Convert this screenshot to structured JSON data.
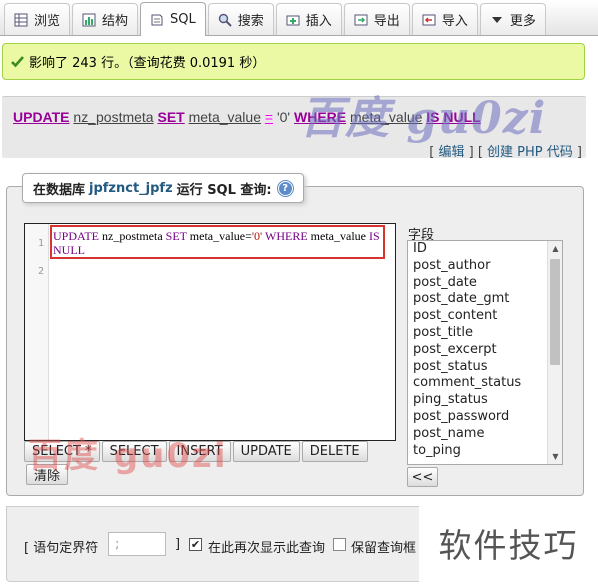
{
  "tabs": [
    {
      "label": "浏览",
      "icon": "browse-icon"
    },
    {
      "label": "结构",
      "icon": "structure-icon"
    },
    {
      "label": "SQL",
      "icon": "sql-icon",
      "active": true
    },
    {
      "label": "搜索",
      "icon": "search-icon"
    },
    {
      "label": "插入",
      "icon": "insert-icon"
    },
    {
      "label": "导出",
      "icon": "export-icon"
    },
    {
      "label": "导入",
      "icon": "import-icon"
    },
    {
      "label": "更多",
      "icon": "chevron-down-icon"
    }
  ],
  "message": {
    "text": "影响了 243 行。（查询花费 0.0191 秒）",
    "color": "#ebf8a4"
  },
  "sql_display": {
    "kw_update": "UPDATE",
    "table": "nz_postmeta",
    "kw_set": "SET",
    "column": "meta_value",
    "op": "=",
    "value": "'0'",
    "kw_where": "WHERE",
    "column2": "meta_value",
    "kw_is_null": "IS NULL",
    "edit_link": "编辑",
    "create_php_link": "创建 PHP 代码"
  },
  "watermark_top": "百度 gu0zi",
  "query_box": {
    "legend_prefix": "在数据库",
    "database": "jpfznct_jpfz",
    "legend_suffix": "运行 SQL 查询:",
    "help_icon": "help-icon"
  },
  "editor": {
    "line_numbers": [
      "1",
      "2"
    ],
    "kw_update": "UPDATE",
    "table": "nz_postmeta",
    "kw_set": "SET",
    "column": "meta_value",
    "op": "=",
    "value": "'0'",
    "kw_where": "WHERE",
    "column2": "meta_value",
    "kw_is": "IS",
    "kw_null": "NULL"
  },
  "buttons": [
    "SELECT *",
    "SELECT",
    "INSERT",
    "UPDATE",
    "DELETE"
  ],
  "clear_button": "清除",
  "watermark_bottom": "百度 gu0zi",
  "columns": {
    "label": "字段",
    "items": [
      "ID",
      "post_author",
      "post_date",
      "post_date_gmt",
      "post_content",
      "post_title",
      "post_excerpt",
      "post_status",
      "comment_status",
      "ping_status",
      "post_password",
      "post_name",
      "to_ping"
    ],
    "insert_button": "<<"
  },
  "options": {
    "delimiter_label": "[ 语句定界符",
    "delimiter_value": ";",
    "bracket_close": "]",
    "show_again_label": "在此再次显示此查询",
    "show_again_checked": true,
    "keep_box_label": "保留查询框"
  },
  "brand": "软件技巧"
}
